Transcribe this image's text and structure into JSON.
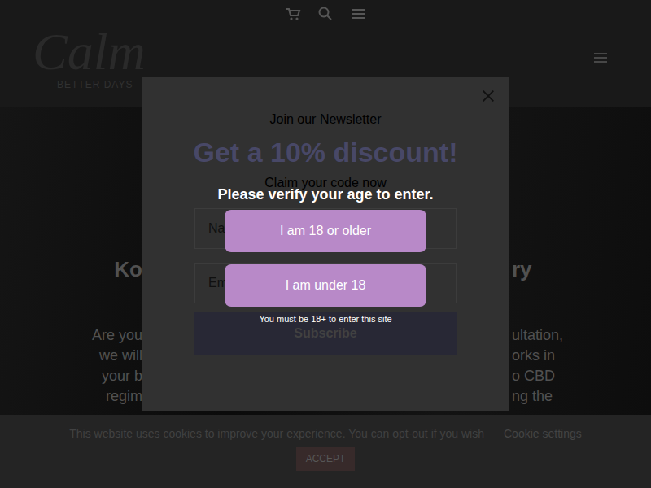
{
  "logo": {
    "script": "Calm",
    "tagline": "BETTER DAYS"
  },
  "hero": {
    "heading_left": "Ko",
    "heading_right": "ry",
    "text_left": [
      "Are you",
      "we will",
      "your b",
      "regim"
    ],
    "text_right": [
      "ultation,",
      "orks in",
      "o CBD",
      "ng the"
    ]
  },
  "newsletter": {
    "title": "Join our Newsletter",
    "headline": "Get a 10% discount!",
    "subtitle": "Claim your code now",
    "fields": [
      {
        "placeholder": "Na"
      },
      {
        "placeholder": "Em"
      }
    ],
    "button": "Subscribe"
  },
  "age_gate": {
    "prompt": "Please verify your age to enter.",
    "buttons": [
      "I am 18 or older",
      "I am under 18"
    ],
    "note": "You must be 18+ to enter this site"
  },
  "cookie_bar": {
    "message": "This website uses cookies to improve your experience. You can opt-out if you wish",
    "settings_link": "Cookie settings",
    "accept": "ACCEPT"
  }
}
